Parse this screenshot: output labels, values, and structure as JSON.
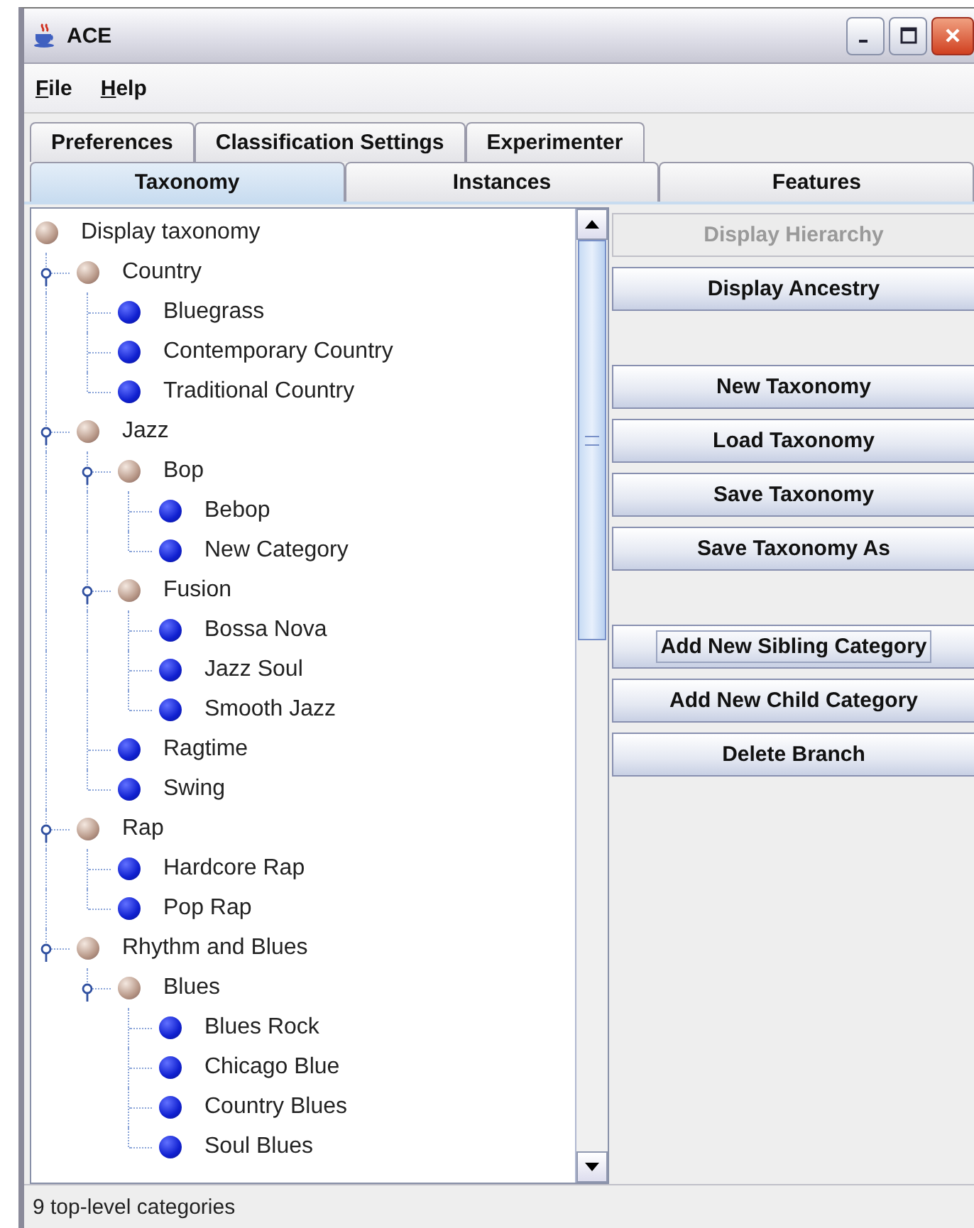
{
  "window": {
    "title": "ACE"
  },
  "menu": [
    {
      "label": "File"
    },
    {
      "label": "Help"
    }
  ],
  "tab_rows": [
    [
      {
        "label": "Preferences",
        "selected": false
      },
      {
        "label": "Classification Settings",
        "selected": false
      },
      {
        "label": "Experimenter",
        "selected": false
      }
    ],
    [
      {
        "label": "Taxonomy",
        "selected": true
      },
      {
        "label": "Instances",
        "selected": false
      },
      {
        "label": "Features",
        "selected": false
      }
    ]
  ],
  "tree": {
    "label": "Display taxonomy",
    "kind": "category",
    "children": [
      {
        "label": "Country",
        "kind": "category",
        "expanded": true,
        "children": [
          {
            "label": "Bluegrass",
            "kind": "leaf"
          },
          {
            "label": "Contemporary Country",
            "kind": "leaf"
          },
          {
            "label": "Traditional Country",
            "kind": "leaf"
          }
        ]
      },
      {
        "label": "Jazz",
        "kind": "category",
        "expanded": true,
        "children": [
          {
            "label": "Bop",
            "kind": "category",
            "expanded": true,
            "children": [
              {
                "label": "Bebop",
                "kind": "leaf"
              },
              {
                "label": "New Category",
                "kind": "leaf"
              }
            ]
          },
          {
            "label": "Fusion",
            "kind": "category",
            "expanded": true,
            "children": [
              {
                "label": "Bossa Nova",
                "kind": "leaf"
              },
              {
                "label": "Jazz Soul",
                "kind": "leaf"
              },
              {
                "label": "Smooth Jazz",
                "kind": "leaf"
              }
            ]
          },
          {
            "label": "Ragtime",
            "kind": "leaf"
          },
          {
            "label": "Swing",
            "kind": "leaf"
          }
        ]
      },
      {
        "label": "Rap",
        "kind": "category",
        "expanded": true,
        "children": [
          {
            "label": "Hardcore Rap",
            "kind": "leaf"
          },
          {
            "label": "Pop Rap",
            "kind": "leaf"
          }
        ]
      },
      {
        "label": "Rhythm and Blues",
        "kind": "category",
        "expanded": true,
        "children": [
          {
            "label": "Blues",
            "kind": "category",
            "expanded": true,
            "children": [
              {
                "label": "Blues Rock",
                "kind": "leaf"
              },
              {
                "label": "Chicago Blue",
                "kind": "leaf"
              },
              {
                "label": "Country Blues",
                "kind": "leaf"
              },
              {
                "label": "Soul Blues",
                "kind": "leaf"
              }
            ]
          }
        ]
      }
    ]
  },
  "button_groups": [
    [
      {
        "label": "Display Hierarchy",
        "disabled": true,
        "focused": false
      },
      {
        "label": "Display Ancestry",
        "disabled": false,
        "focused": false
      }
    ],
    [
      {
        "label": "New Taxonomy",
        "disabled": false,
        "focused": false
      },
      {
        "label": "Load Taxonomy",
        "disabled": false,
        "focused": false
      },
      {
        "label": "Save Taxonomy",
        "disabled": false,
        "focused": false
      },
      {
        "label": "Save Taxonomy As",
        "disabled": false,
        "focused": false
      }
    ],
    [
      {
        "label": "Add New Sibling Category",
        "disabled": false,
        "focused": true
      },
      {
        "label": "Add New Child Category",
        "disabled": false,
        "focused": false
      },
      {
        "label": "Delete Branch",
        "disabled": false,
        "focused": false
      }
    ]
  ],
  "status_bar": "9 top-level categories"
}
